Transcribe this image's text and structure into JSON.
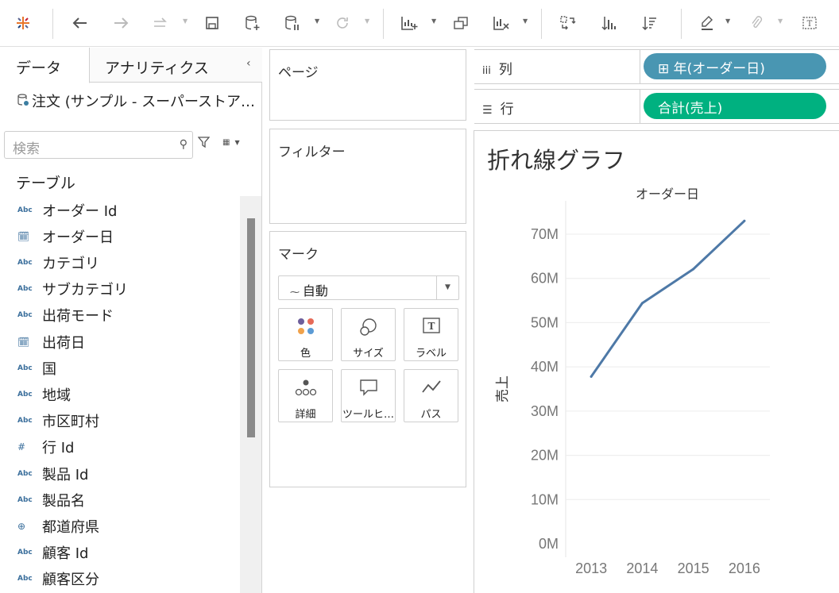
{
  "toolbar": {
    "items": [
      {
        "icon": "tableau-logo-icon",
        "enabled": true
      },
      {
        "icon": "undo-icon",
        "enabled": true
      },
      {
        "icon": "redo-icon",
        "enabled": false
      },
      {
        "icon": "replay-icon",
        "enabled": false
      },
      {
        "icon": "save-icon",
        "enabled": true
      },
      {
        "icon": "new-datasource-icon",
        "enabled": true
      },
      {
        "icon": "pause-updates-icon",
        "enabled": true
      },
      {
        "icon": "refresh-icon",
        "enabled": false
      },
      {
        "icon": "new-worksheet-icon",
        "enabled": true
      },
      {
        "icon": "duplicate-icon",
        "enabled": true
      },
      {
        "icon": "clear-sheet-icon",
        "enabled": true
      },
      {
        "icon": "swap-icon",
        "enabled": true
      },
      {
        "icon": "sort-ascending-icon",
        "enabled": true
      },
      {
        "icon": "sort-descending-icon",
        "enabled": true
      },
      {
        "icon": "highlight-icon",
        "enabled": true
      },
      {
        "icon": "attach-icon",
        "enabled": false
      },
      {
        "icon": "show-labels-icon",
        "enabled": true
      }
    ]
  },
  "left_pane": {
    "tabs": [
      {
        "label": "データ",
        "active": true
      },
      {
        "label": "アナリティクス",
        "active": false
      }
    ],
    "datasource": "注文 (サンプル - スーパーストア…",
    "search": {
      "placeholder": "検索"
    },
    "table_header": "テーブル",
    "fields": [
      {
        "type": "Abc",
        "name": "オーダー Id"
      },
      {
        "type": "date",
        "name": "オーダー日"
      },
      {
        "type": "Abc",
        "name": "カテゴリ"
      },
      {
        "type": "Abc",
        "name": "サブカテゴリ"
      },
      {
        "type": "Abc",
        "name": "出荷モード"
      },
      {
        "type": "date",
        "name": "出荷日"
      },
      {
        "type": "Abc",
        "name": "国"
      },
      {
        "type": "Abc",
        "name": "地域"
      },
      {
        "type": "Abc",
        "name": "市区町村"
      },
      {
        "type": "#",
        "name": "行 Id"
      },
      {
        "type": "Abc",
        "name": "製品 Id"
      },
      {
        "type": "Abc",
        "name": "製品名"
      },
      {
        "type": "geo",
        "name": "都道府県"
      },
      {
        "type": "Abc",
        "name": "顧客 Id"
      },
      {
        "type": "Abc",
        "name": "顧客区分"
      }
    ]
  },
  "cards": {
    "pages": "ページ",
    "filters": "フィルター",
    "marks": {
      "title": "マーク",
      "type": "自動",
      "buttons": [
        "色",
        "サイズ",
        "ラベル",
        "詳細",
        "ツールヒ…",
        "パス"
      ]
    }
  },
  "shelves": {
    "columns": {
      "label": "列",
      "pill": "⊞ 年(オーダー日)",
      "color": "#4996b2"
    },
    "rows": {
      "label": "行",
      "pill": "合計(売上)",
      "color": "#00b180"
    }
  },
  "viz": {
    "sheet_title": "折れ線グラフ",
    "line_color": "#4e79a7"
  },
  "chart_data": {
    "type": "line",
    "title": "折れ線グラフ",
    "xlabel": "オーダー日",
    "ylabel": "売上",
    "categories": [
      "2013",
      "2014",
      "2015",
      "2016"
    ],
    "series": [
      {
        "values": [
          37800000,
          54400000,
          62100000,
          73000000
        ]
      }
    ],
    "ylim": [
      0,
      70000000
    ],
    "yticks": [
      0,
      10000000,
      20000000,
      30000000,
      40000000,
      50000000,
      60000000,
      70000000
    ],
    "ytick_labels": [
      "0M",
      "10M",
      "20M",
      "30M",
      "40M",
      "50M",
      "60M",
      "70M"
    ],
    "grid": true
  }
}
